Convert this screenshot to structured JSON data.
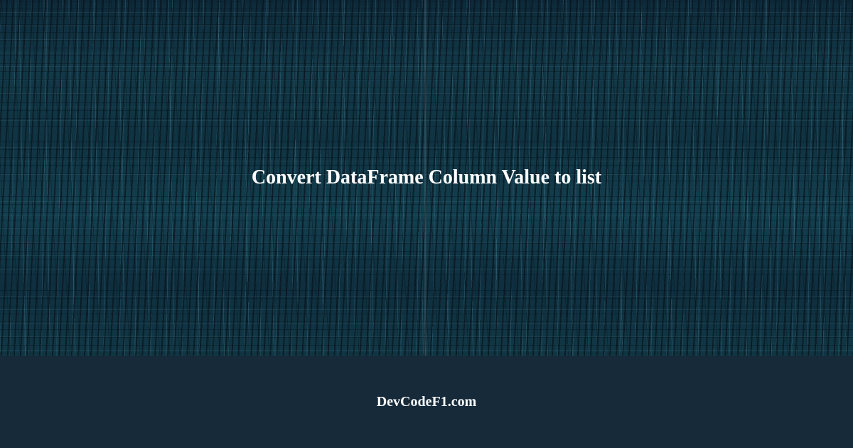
{
  "hero": {
    "title": "Convert DataFrame Column Value to list"
  },
  "footer": {
    "brand": "DevCodeF1.com"
  }
}
